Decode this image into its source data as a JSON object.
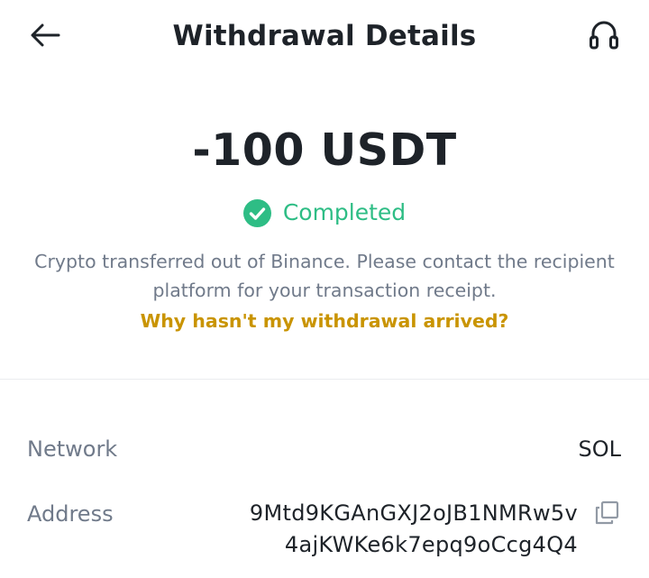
{
  "header": {
    "title": "Withdrawal Details",
    "back_icon": "arrow-left-icon",
    "support_icon": "headset-icon"
  },
  "summary": {
    "amount": "-100 USDT",
    "status": "Completed",
    "status_icon": "check-circle-icon",
    "status_color": "#2ebd85",
    "description": "Crypto transferred out of Binance. Please contact the recipient platform for your transaction receipt.",
    "help_link": "Why hasn't my withdrawal arrived?",
    "link_color": "#c99400"
  },
  "details": {
    "network": {
      "label": "Network",
      "value": "SOL"
    },
    "address": {
      "label": "Address",
      "value_line1": "9Mtd9KGAnGXJ2oJB1NMRw5v",
      "value_line2": "4ajKWKe6k7epq9oCcg4Q4",
      "copy_icon": "copy-icon"
    }
  }
}
